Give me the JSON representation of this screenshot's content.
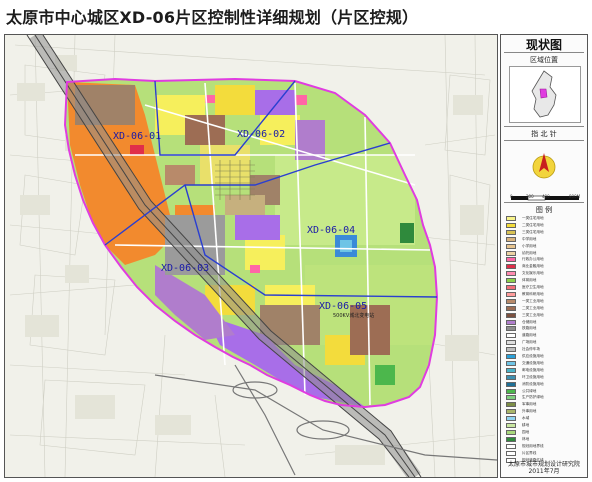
{
  "title": "太原市中心城区XD-06片区控制性详细规划（片区控规）",
  "panel": {
    "title": "现状图",
    "location_label": "区域位置",
    "north_label": "指 北 针",
    "legend_label": "图 例",
    "scale_labels": [
      "0",
      "200",
      "400",
      "800M"
    ],
    "org": "太原市城市规划设计研究院",
    "date": "2011年7月"
  },
  "map": {
    "zone_labels": [
      "XD-06-01",
      "XD-06-02",
      "XD-06-03",
      "XD-06-04",
      "XD-06-05"
    ],
    "annotation": "500KV城北变电站"
  },
  "legend": {
    "items": [
      {
        "label": "一类住宅用地",
        "color": "#f7f38a"
      },
      {
        "label": "二类住宅用地",
        "color": "#f3dc3c"
      },
      {
        "label": "三类住宅用地",
        "color": "#d8c254"
      },
      {
        "label": "中学用地",
        "color": "#d8b37e"
      },
      {
        "label": "小学用地",
        "color": "#e7c48f"
      },
      {
        "label": "幼托用地",
        "color": "#ecd3a4"
      },
      {
        "label": "行政办公用地",
        "color": "#ff66a6"
      },
      {
        "label": "商业金融用地",
        "color": "#e02e4a"
      },
      {
        "label": "文化娱乐用地",
        "color": "#ff8ab0"
      },
      {
        "label": "体育用地",
        "color": "#8dd24a"
      },
      {
        "label": "医疗卫生用地",
        "color": "#f26f7a"
      },
      {
        "label": "教育科研用地",
        "color": "#ff9c9c"
      },
      {
        "label": "一类工业用地",
        "color": "#b88a6a"
      },
      {
        "label": "二类工业用地",
        "color": "#9d6d54"
      },
      {
        "label": "三类工业用地",
        "color": "#7c5140"
      },
      {
        "label": "仓储用地",
        "color": "#b07dcc"
      },
      {
        "label": "铁路用地",
        "color": "#8e8e8e"
      },
      {
        "label": "道路用地",
        "color": "#ffffff"
      },
      {
        "label": "广场用地",
        "color": "#dedede"
      },
      {
        "label": "社会停车场",
        "color": "#bdbdbd"
      },
      {
        "label": "供应设施用地",
        "color": "#2aa0d8"
      },
      {
        "label": "交通设施用地",
        "color": "#6ec4e6"
      },
      {
        "label": "邮电设施用地",
        "color": "#49b3c8"
      },
      {
        "label": "环卫设施用地",
        "color": "#3d8fb0"
      },
      {
        "label": "消防设施用地",
        "color": "#1e6f96"
      },
      {
        "label": "公共绿地",
        "color": "#4cb74c"
      },
      {
        "label": "生产防护绿地",
        "color": "#7fd07f"
      },
      {
        "label": "军事用地",
        "color": "#7d8e47"
      },
      {
        "label": "外事用地",
        "color": "#a9b56a"
      },
      {
        "label": "水域",
        "color": "#8fd3f0"
      },
      {
        "label": "耕地",
        "color": "#c8e6a0"
      },
      {
        "label": "园地",
        "color": "#a8d87c"
      },
      {
        "label": "林地",
        "color": "#2f8a3c"
      },
      {
        "label": "规划用地界线",
        "color": "#ffffff"
      },
      {
        "label": "片区界线",
        "color": "#ffffff"
      },
      {
        "label": "规划道路红线",
        "color": "#ffffff"
      }
    ]
  },
  "colors": {
    "boundary": "#e03ce0",
    "zone_line": "#2a3fd0",
    "label": "#1a1aa8",
    "green_base": "#b6e07a",
    "orange": "#f28a2e",
    "purple": "#a86ee8",
    "brown": "#a08268",
    "yellow": "#f6ef5c",
    "rail": "#555555",
    "blue": "#3a8ad8"
  }
}
